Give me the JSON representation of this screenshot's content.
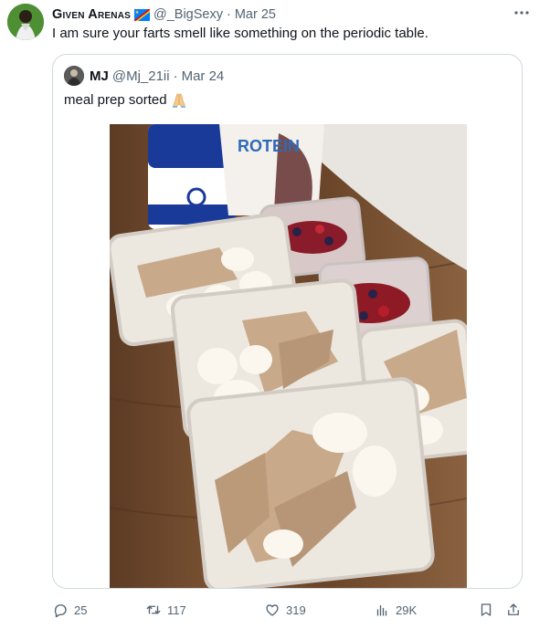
{
  "tweet": {
    "author": {
      "display_name": "Given Arenas",
      "handle": "@_BigSexy",
      "time": "Mar 25"
    },
    "text": "I am sure your farts smell like something on the periodic table.",
    "more_icon": "more-icon"
  },
  "quote": {
    "author": {
      "display_name": "MJ",
      "handle": "@Mj_21ii",
      "time": "Mar 24"
    },
    "text": "meal prep sorted",
    "emoji_icon": "praying-hands-icon",
    "media": {
      "alt": "meal prep containers with chicken, eggs and berries",
      "brand_text": "ROTEIN"
    }
  },
  "actions": {
    "reply_count": "25",
    "retweet_count": "117",
    "like_count": "319",
    "views_count": "29K"
  },
  "colors": {
    "text_primary": "#0f1419",
    "text_secondary": "#536471",
    "border": "#cfd9de"
  }
}
